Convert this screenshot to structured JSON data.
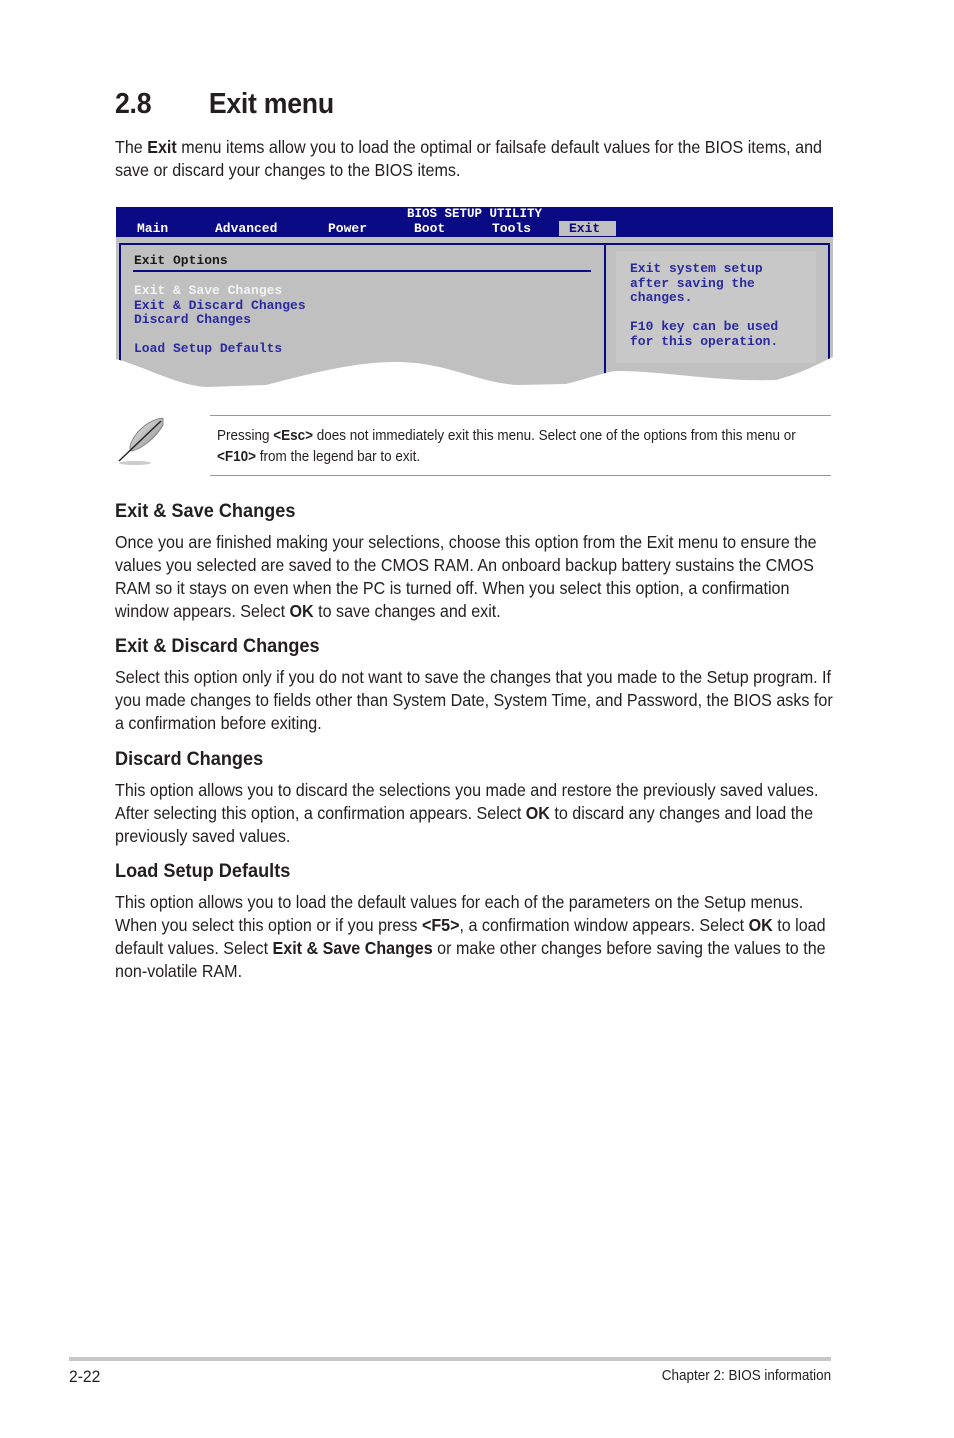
{
  "section": {
    "number": "2.8",
    "title": "Exit menu"
  },
  "intro": {
    "pre": "The ",
    "bold": "Exit",
    "post": " menu items allow you to load the optimal or failsafe default values for the BIOS items, and save or discard your changes to the BIOS items."
  },
  "bios": {
    "title": "BIOS SETUP UTILITY",
    "tabs": [
      "Main",
      "Advanced",
      "Power",
      "Boot",
      "Tools",
      "Exit"
    ],
    "active_tab": "Exit",
    "panel_heading": "Exit Options",
    "items": [
      "Exit & Save Changes",
      "Exit & Discard Changes",
      "Discard Changes",
      "Load Setup Defaults"
    ],
    "selected_item": "Exit & Save Changes",
    "help_lines": [
      "Exit system setup",
      "after saving the",
      "changes.",
      "",
      "F10 key can be used",
      "for this operation."
    ],
    "colors": {
      "header": "#0a0a84",
      "body": "#c0c0c0",
      "item": "#2a2aa0",
      "selected": "#f2f2f2"
    }
  },
  "note": {
    "icon": "feather-pen-icon",
    "t1": "Pressing ",
    "b1": "<Esc>",
    "t2": " does not immediately exit this menu. Select one of the options from this menu or ",
    "b2": "<F10>",
    "t3": " from the legend bar to exit."
  },
  "sections": [
    {
      "heading": "Exit & Save Changes",
      "t1": "Once you are finished making your selections, choose this option from the Exit menu to ensure the values you selected are saved to the CMOS RAM. An onboard backup battery sustains the CMOS RAM so it stays on even when the PC is turned off. When you select this option, a confirmation window appears. Select ",
      "b1": "OK",
      "t2": " to save changes and exit."
    },
    {
      "heading": "Exit & Discard Changes",
      "t1": "Select this option only if you do not want to save the changes that you made to the Setup program. If you made changes to fields other than System Date, System Time, and Password, the BIOS asks for a confirmation before exiting."
    },
    {
      "heading": "Discard Changes",
      "t1": "This option allows you to discard the selections you made and restore the previously saved values. After selecting this option, a confirmation appears. Select ",
      "b1": "OK",
      "t2": " to discard any changes and load the previously saved values."
    },
    {
      "heading": "Load Setup Defaults",
      "t1": "This option allows you to load the default values for each of the parameters on the Setup menus. When you select this option or if you press ",
      "b1": "<F5>",
      "t2": ", a confirmation window appears. Select ",
      "b2": "OK",
      "t3": " to load default values. Select ",
      "b3": "Exit & Save Changes",
      "t4": " or make other changes before saving the values to the non-volatile RAM."
    }
  ],
  "footer": {
    "page_number": "2-22",
    "chapter": "Chapter 2: BIOS information"
  }
}
